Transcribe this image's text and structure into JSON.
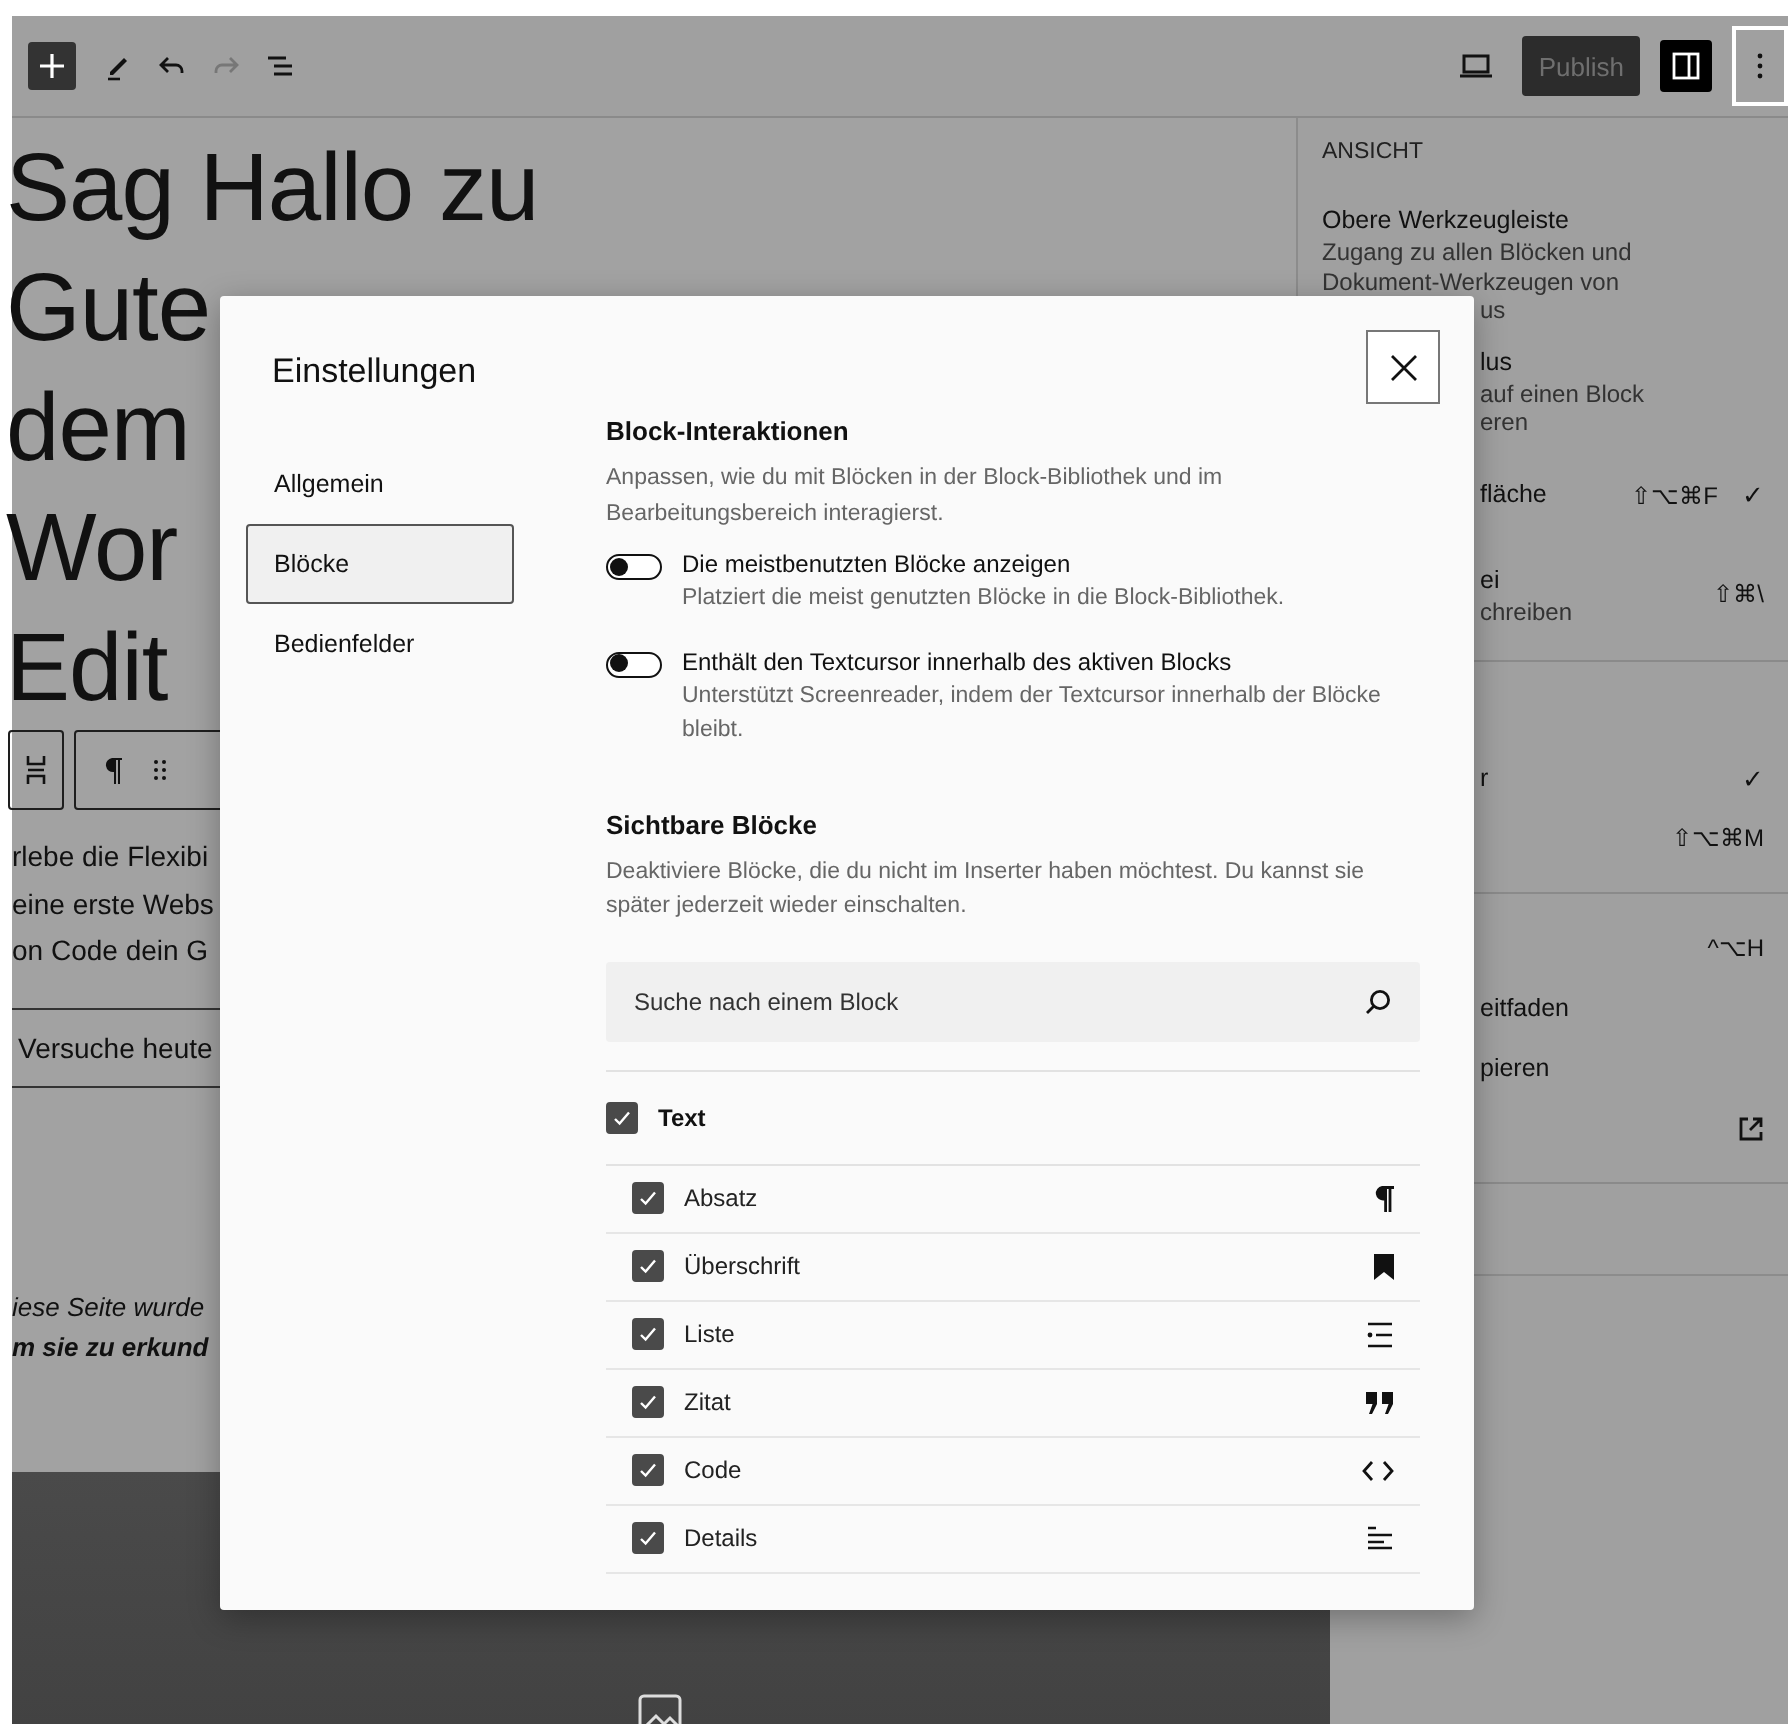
{
  "toolbar": {
    "tools": [
      {
        "kind": "inserter",
        "disabled": false
      },
      {
        "kind": "pen",
        "disabled": false
      },
      {
        "kind": "undo",
        "disabled": false
      },
      {
        "kind": "redo",
        "disabled": true
      },
      {
        "kind": "list-view",
        "disabled": false
      }
    ],
    "publish": "Publish",
    "options_selected": true
  },
  "editor": {
    "heading_lines": [
      "Sag Hallo zu",
      "Gute",
      "dem",
      "Wor",
      "Edit"
    ],
    "paragraph_lines": [
      "rlebe die Flexibi",
      "eine erste Webs",
      "on Code dein G"
    ],
    "button": "Versuche heute",
    "footnote_lines": [
      {
        "text": "iese Seite wurde",
        "bold": false
      },
      {
        "text": "m sie zu erkund",
        "bold": true
      }
    ]
  },
  "menu": {
    "heading": "ANSICHT",
    "sections": [
      {
        "items": [
          {
            "lines": [
              {
                "text": "Obere Werkzeugleiste",
                "cut": false,
                "main": true
              },
              {
                "text": "Zugang zu allen Blöcken und",
                "cut": false,
                "main": false
              },
              {
                "text": "Dokument-Werkzeugen von",
                "cut": false,
                "main": false
              },
              {
                "text": "us",
                "cut": true,
                "main": false
              }
            ]
          },
          {
            "lines": [
              {
                "text": "lus",
                "cut": true,
                "main": true
              },
              {
                "text": "auf einen Block",
                "cut": true,
                "main": false
              },
              {
                "text": "eren",
                "cut": true,
                "main": false
              }
            ]
          },
          {
            "lines": [
              {
                "text": "fläche",
                "cut": true,
                "main": true
              }
            ],
            "shortcut": "⇧⌥⌘F",
            "check": "✓"
          },
          {
            "lines": [
              {
                "text": "ei",
                "cut": true,
                "main": true
              },
              {
                "text": "chreiben",
                "cut": true,
                "main": false
              }
            ],
            "shortcut": "⇧⌘\\"
          }
        ]
      },
      {
        "items": [
          {
            "lines": [
              {
                "text": "r",
                "cut": true,
                "main": true
              }
            ],
            "check": "✓"
          },
          {
            "shortcut": "⇧⌥⌘M"
          }
        ]
      },
      {
        "items": [
          {
            "shortcut": "^⌥H"
          },
          {
            "lines": [
              {
                "text": "eitfaden",
                "cut": true,
                "main": true
              }
            ]
          },
          {
            "lines": [
              {
                "text": "pieren",
                "cut": true,
                "main": true
              }
            ]
          },
          {
            "external": true
          }
        ]
      }
    ]
  },
  "dialog": {
    "title": "Einstellungen",
    "nav": [
      {
        "label": "Allgemein",
        "selected": false
      },
      {
        "label": "Blöcke",
        "selected": true
      },
      {
        "label": "Bedienfelder",
        "selected": false
      }
    ],
    "interactions": {
      "title": "Block-Interaktionen",
      "description": "Anpassen, wie du mit Blöcken in der Block-Bibliothek und im Bearbeitungsbereich interagierst.",
      "toggles": [
        {
          "label": "Die meistbenutzten Blöcke anzeigen",
          "description": "Platziert die meist genutzten Blöcke in die Block-Bibliothek.",
          "on": false
        },
        {
          "label": "Enthält den Textcursor innerhalb des aktiven Blocks",
          "description": "Unterstützt Screenreader, indem der Textcursor innerhalb der Blöcke bleibt.",
          "on": false
        }
      ]
    },
    "visible_blocks": {
      "title": "Sichtbare Blöcke",
      "description": "Deaktiviere Blöcke, die du nicht im Inserter haben möchtest. Du kannst sie später jederzeit wieder einschalten.",
      "search_placeholder": "Suche nach einem Block",
      "category": {
        "label": "Text",
        "checked": true,
        "blocks": [
          {
            "label": "Absatz",
            "checked": true,
            "kind": "paragraph"
          },
          {
            "label": "Überschrift",
            "checked": true,
            "kind": "heading"
          },
          {
            "label": "Liste",
            "checked": true,
            "kind": "list"
          },
          {
            "label": "Zitat",
            "checked": true,
            "kind": "quote"
          },
          {
            "label": "Code",
            "checked": true,
            "kind": "code"
          },
          {
            "label": "Details",
            "checked": true,
            "kind": "details"
          }
        ]
      }
    }
  }
}
